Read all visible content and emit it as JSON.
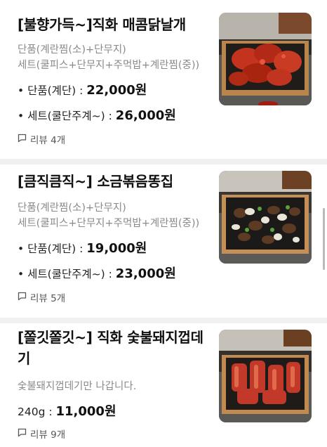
{
  "menu": [
    {
      "title_lines": [
        "[불향가득~]직화 매콤닭날개"
      ],
      "desc_lines": [
        "단품(계란찜(소)+단무지)",
        "세트(쿨피스+단무지+주먹밥+계란찜(중))"
      ],
      "prices": [
        {
          "label": "• 단품(계단) : ",
          "amount": "22,000원"
        },
        {
          "label": "• 세트(쿨단주계~) : ",
          "amount": "26,000원"
        }
      ],
      "review": "리뷰 4개",
      "image": "spicy-chicken-wings"
    },
    {
      "title_lines": [
        "[큼직큼직~] 소금볶음똥집"
      ],
      "desc_lines": [
        "단품(계란찜(소)+단무지)",
        "세트(쿨피스+단무지+주먹밥+계란찜(중))"
      ],
      "prices": [
        {
          "label": "• 단품(계단) : ",
          "amount": "19,000원"
        },
        {
          "label": "• 세트(쿨단주계~) : ",
          "amount": "23,000원"
        }
      ],
      "review": "리뷰 5개",
      "image": "salt-stir-fried-gizzard"
    },
    {
      "title_lines": [
        "[쫄깃쫄깃~] 직화 숯불돼지껍데",
        "기"
      ],
      "desc_lines": [
        "숯불돼지껍데기만 나갑니다."
      ],
      "prices": [
        {
          "label": "240g : ",
          "amount": "11,000원"
        }
      ],
      "review": "리뷰 9개",
      "image": "charcoal-pork-skin"
    }
  ],
  "icons": {
    "review": "speech-bubble-icon"
  },
  "colors": {
    "separator": "#f0f0f1",
    "text_secondary": "#8a8a8a",
    "accent_sauce": "#c2301e"
  }
}
